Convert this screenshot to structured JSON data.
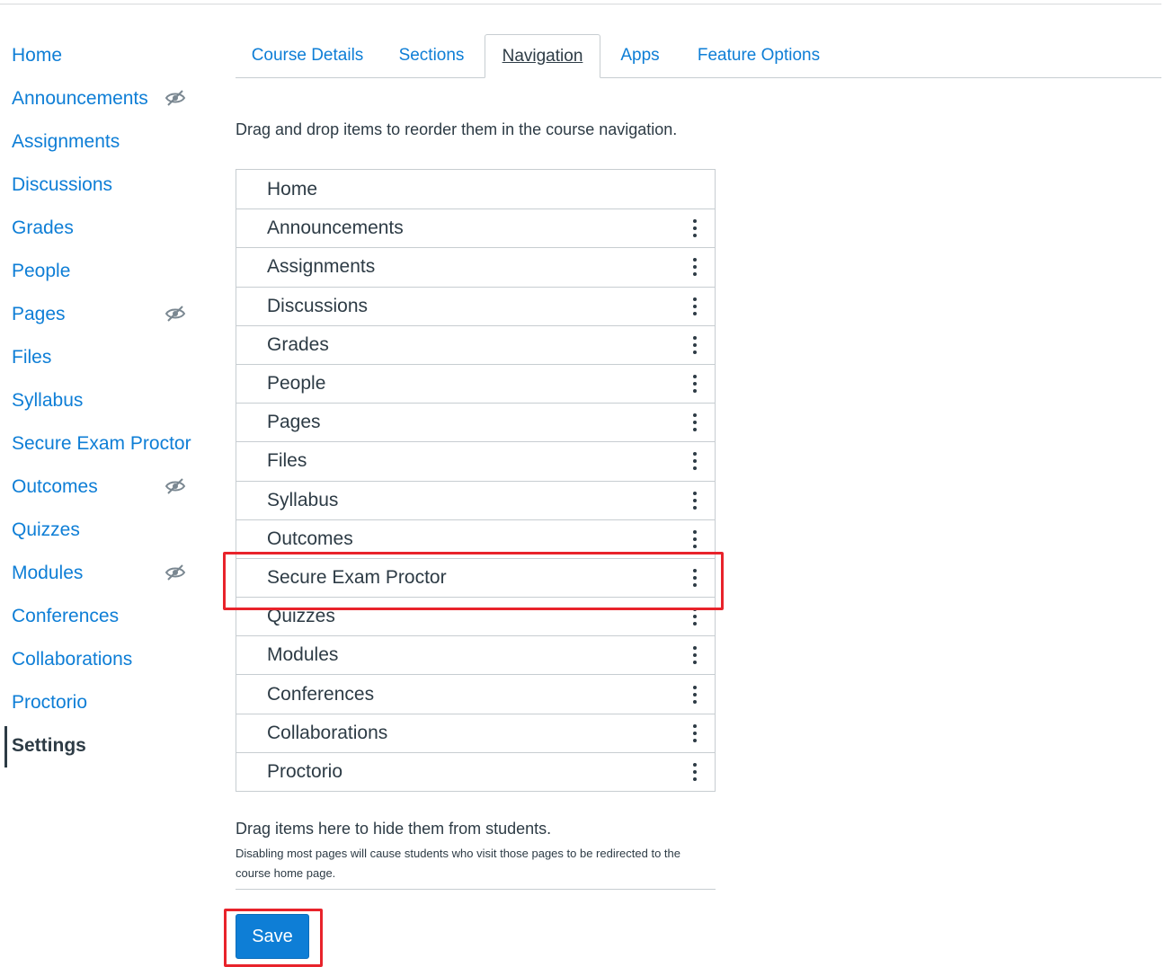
{
  "course_nav": {
    "items": [
      {
        "label": "Home",
        "hidden": false
      },
      {
        "label": "Announcements",
        "hidden": true
      },
      {
        "label": "Assignments",
        "hidden": false
      },
      {
        "label": "Discussions",
        "hidden": false
      },
      {
        "label": "Grades",
        "hidden": false
      },
      {
        "label": "People",
        "hidden": false
      },
      {
        "label": "Pages",
        "hidden": true
      },
      {
        "label": "Files",
        "hidden": false
      },
      {
        "label": "Syllabus",
        "hidden": false
      },
      {
        "label": "Secure Exam Proctor",
        "hidden": false
      },
      {
        "label": "Outcomes",
        "hidden": true
      },
      {
        "label": "Quizzes",
        "hidden": false
      },
      {
        "label": "Modules",
        "hidden": true
      },
      {
        "label": "Conferences",
        "hidden": false
      },
      {
        "label": "Collaborations",
        "hidden": false
      },
      {
        "label": "Proctorio",
        "hidden": false
      },
      {
        "label": "Settings",
        "hidden": false,
        "active": true
      }
    ]
  },
  "tabs": [
    {
      "label": "Course Details",
      "active": false
    },
    {
      "label": "Sections",
      "active": false
    },
    {
      "label": "Navigation",
      "active": true
    },
    {
      "label": "Apps",
      "active": false
    },
    {
      "label": "Feature Options",
      "active": false
    }
  ],
  "navigation_panel": {
    "instructions": "Drag and drop items to reorder them in the course navigation.",
    "items": [
      {
        "label": "Home",
        "has_menu": false
      },
      {
        "label": "Announcements",
        "has_menu": true
      },
      {
        "label": "Assignments",
        "has_menu": true
      },
      {
        "label": "Discussions",
        "has_menu": true
      },
      {
        "label": "Grades",
        "has_menu": true
      },
      {
        "label": "People",
        "has_menu": true
      },
      {
        "label": "Pages",
        "has_menu": true
      },
      {
        "label": "Files",
        "has_menu": true
      },
      {
        "label": "Syllabus",
        "has_menu": true
      },
      {
        "label": "Outcomes",
        "has_menu": true
      },
      {
        "label": "Secure Exam Proctor",
        "has_menu": true,
        "highlighted": true
      },
      {
        "label": "Quizzes",
        "has_menu": true
      },
      {
        "label": "Modules",
        "has_menu": true
      },
      {
        "label": "Conferences",
        "has_menu": true
      },
      {
        "label": "Collaborations",
        "has_menu": true
      },
      {
        "label": "Proctorio",
        "has_menu": true
      }
    ],
    "hidden_zone_title": "Drag items here to hide them from students.",
    "hidden_zone_note": "Disabling most pages will cause students who visit those pages to be redirected to the course home page.",
    "save_label": "Save"
  },
  "colors": {
    "link": "#0e7ed6",
    "text": "#2d3b45",
    "highlight": "#e8232b",
    "save_button": "#0e7ed6"
  },
  "icons": {
    "hidden": "eye-slash-icon",
    "menu": "vertical-dots-icon"
  }
}
